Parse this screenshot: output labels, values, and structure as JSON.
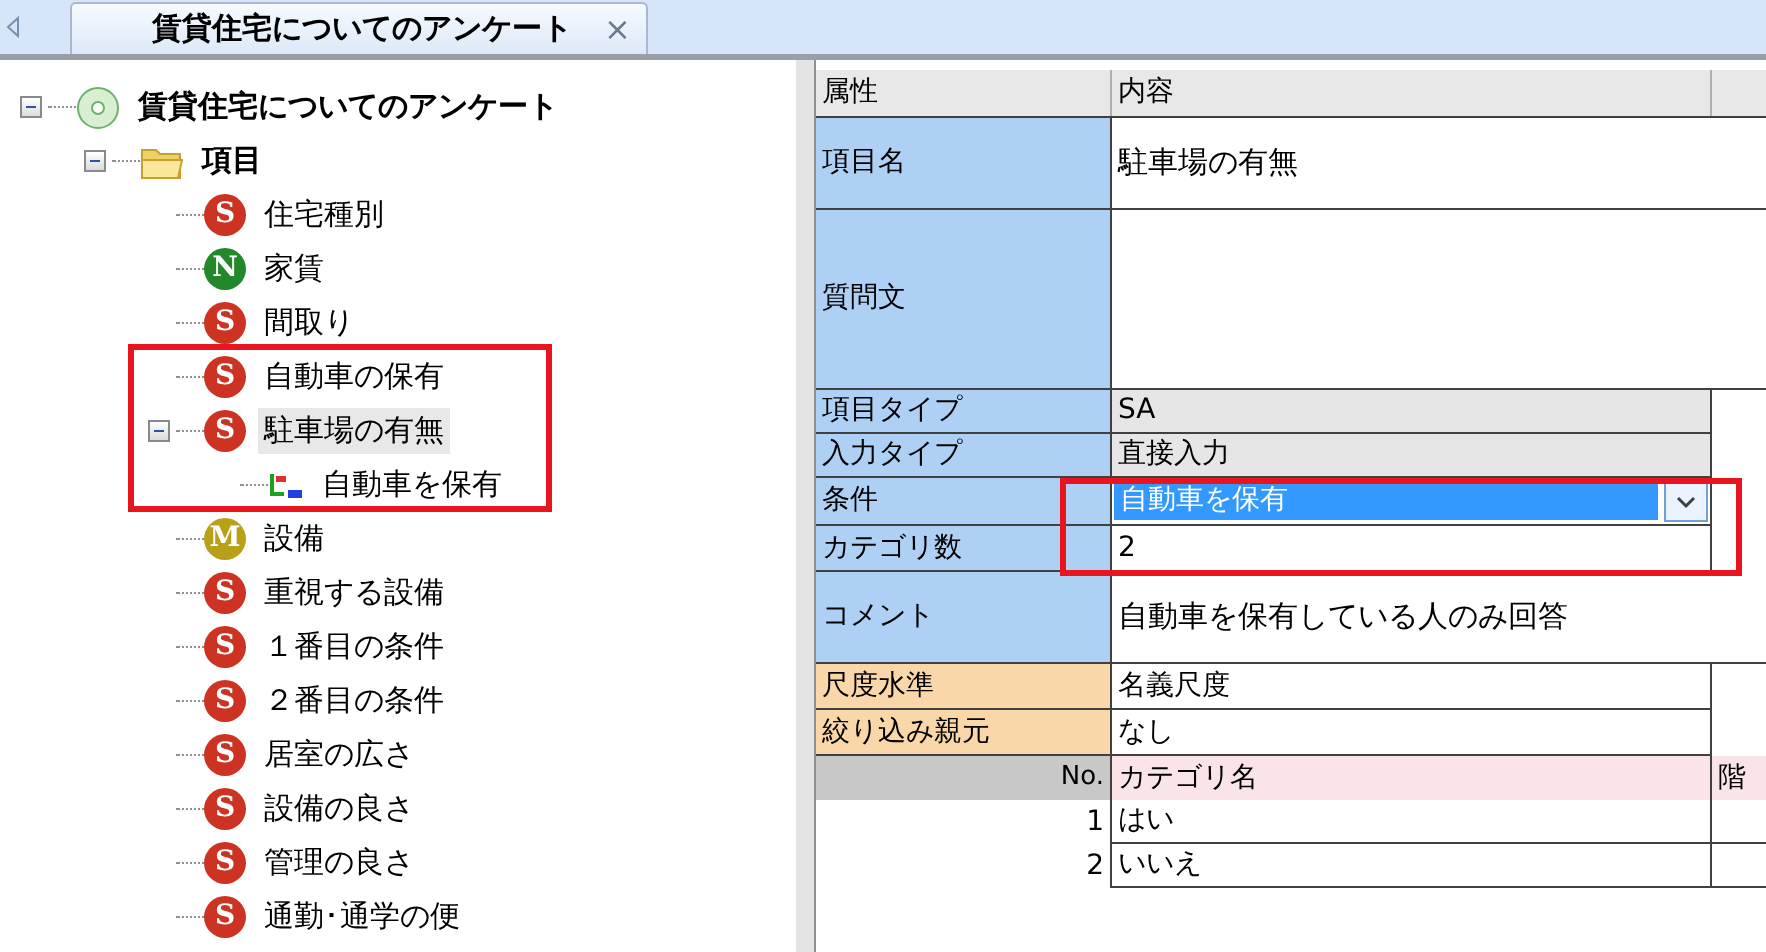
{
  "tab": {
    "title": "賃貸住宅についてのアンケート",
    "close": "×"
  },
  "tree": {
    "label": "賃貸住宅についてのアンケート",
    "kind": "root",
    "expanded": true,
    "selected": false,
    "children": [
      {
        "label": "項目",
        "kind": "folder",
        "expanded": true,
        "selected": false,
        "children": [
          {
            "label": "住宅種別",
            "kind": "item",
            "badge": "S",
            "color": "#cc3322",
            "selected": false
          },
          {
            "label": "家賃",
            "kind": "item",
            "badge": "N",
            "color": "#22882a",
            "selected": false
          },
          {
            "label": "間取り",
            "kind": "item",
            "badge": "S",
            "color": "#cc3322",
            "selected": false
          },
          {
            "label": "自動車の保有",
            "kind": "item",
            "badge": "S",
            "color": "#cc3322",
            "selected": false
          },
          {
            "label": "駐車場の有無",
            "kind": "item",
            "badge": "S",
            "color": "#cc3322",
            "selected": true,
            "expanded": true,
            "children": [
              {
                "label": "自動車を保有",
                "kind": "condition",
                "selected": false
              }
            ]
          },
          {
            "label": "設備",
            "kind": "item",
            "badge": "M",
            "color": "#b8a018",
            "selected": false
          },
          {
            "label": "重視する設備",
            "kind": "item",
            "badge": "S",
            "color": "#cc3322",
            "selected": false
          },
          {
            "label": "１番目の条件",
            "kind": "item",
            "badge": "S",
            "color": "#cc3322",
            "selected": false
          },
          {
            "label": "２番目の条件",
            "kind": "item",
            "badge": "S",
            "color": "#cc3322",
            "selected": false
          },
          {
            "label": "居室の広さ",
            "kind": "item",
            "badge": "S",
            "color": "#cc3322",
            "selected": false
          },
          {
            "label": "設備の良さ",
            "kind": "item",
            "badge": "S",
            "color": "#cc3322",
            "selected": false
          },
          {
            "label": "管理の良さ",
            "kind": "item",
            "badge": "S",
            "color": "#cc3322",
            "selected": false
          },
          {
            "label": "通勤･通学の便",
            "kind": "item",
            "badge": "S",
            "color": "#cc3322",
            "selected": false
          }
        ]
      }
    ]
  },
  "properties": {
    "columns": [
      "属性",
      "内容"
    ],
    "rows": [
      {
        "label": "項目名",
        "value": "駐車場の有無",
        "kind": "text",
        "color": "#aed0f5"
      },
      {
        "label": "質問文",
        "kind": "multiline",
        "color": "#aed0f5"
      },
      {
        "label": "項目タイプ",
        "value": "SA",
        "kind": "readonly",
        "color": "#aed0f5"
      },
      {
        "label": "入力タイプ",
        "value": "直接入力",
        "kind": "readonly",
        "color": "#aed0f5"
      },
      {
        "label": "条件",
        "value": "自動車を保有",
        "kind": "dropdown",
        "color": "#aed0f5"
      },
      {
        "label": "カテゴリ数",
        "value": "2",
        "kind": "short",
        "color": "#aed0f5"
      },
      {
        "label": "コメント",
        "value": "自動車を保有している人のみ回答",
        "kind": "text",
        "color": "#aed0f5"
      },
      {
        "label": "尺度水準",
        "value": "名義尺度",
        "kind": "short",
        "color": "#fad7a8"
      },
      {
        "label": "絞り込み親元",
        "value": "なし",
        "kind": "short",
        "color": "#fad7a8"
      }
    ]
  },
  "categories": {
    "columns": [
      "No.",
      "カテゴリ名",
      "階"
    ],
    "rows": [
      {
        "no": "1",
        "name": "はい"
      },
      {
        "no": "2",
        "name": "いいえ"
      }
    ]
  }
}
